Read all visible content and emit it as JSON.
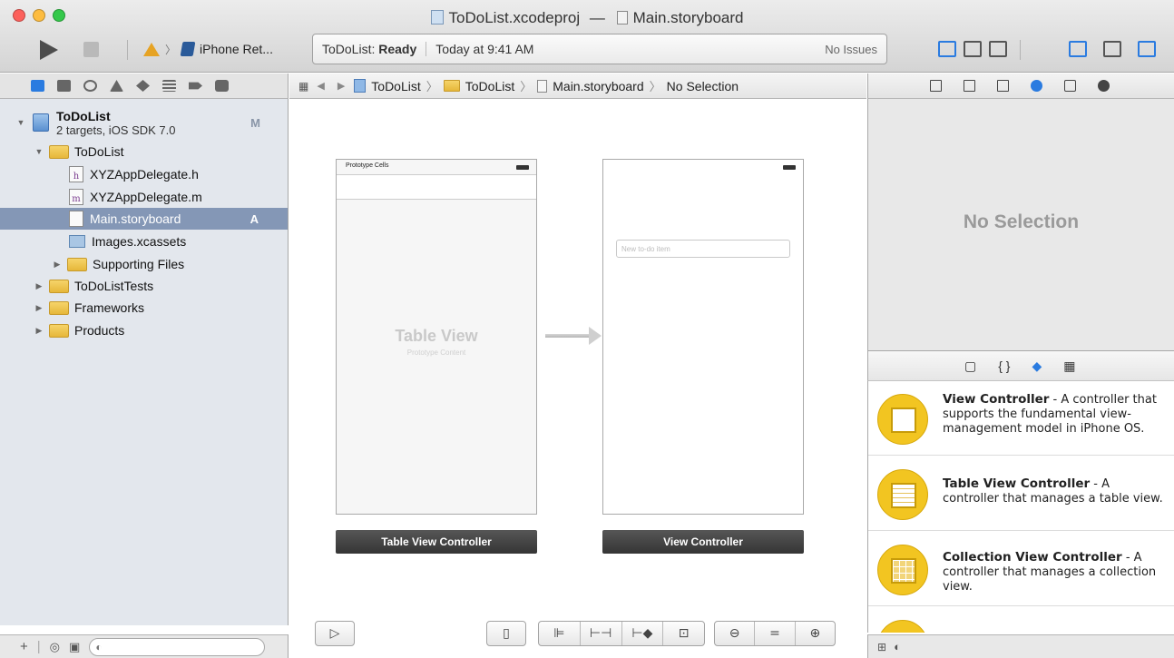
{
  "window": {
    "title_project": "ToDoList.xcodeproj",
    "title_sep": "—",
    "title_file": "Main.storyboard",
    "colors": {
      "close": "#fc605b",
      "minimize": "#fdbc40",
      "zoom": "#34c84a",
      "selection": "#8497b6",
      "accent_blue": "#2a7be0"
    }
  },
  "toolbar": {
    "scheme_device": "iPhone Ret...",
    "activity_project": "ToDoList:",
    "activity_status": "Ready",
    "activity_time": "Today at 9:41 AM",
    "activity_issues": "No Issues"
  },
  "navigator": {
    "project": {
      "name": "ToDoList",
      "subtitle": "2 targets, iOS SDK 7.0",
      "badge": "M"
    },
    "items": [
      {
        "label": "ToDoList"
      },
      {
        "label": "XYZAppDelegate.h"
      },
      {
        "label": "XYZAppDelegate.m"
      },
      {
        "label": "Main.storyboard",
        "badge": "A"
      },
      {
        "label": "Images.xcassets"
      },
      {
        "label": "Supporting Files"
      },
      {
        "label": "ToDoListTests"
      },
      {
        "label": "Frameworks"
      },
      {
        "label": "Products"
      }
    ]
  },
  "jumpbar": {
    "crumbs": [
      "ToDoList",
      "ToDoList",
      "Main.storyboard",
      "No Selection"
    ]
  },
  "canvas": {
    "table_scene": {
      "status_text": "Prototype Cells",
      "title": "Table View",
      "subtitle": "Prototype Content",
      "label": "Table View Controller"
    },
    "view_scene": {
      "placeholder": "New to-do item",
      "label": "View Controller"
    }
  },
  "inspector": {
    "empty_text": "No Selection"
  },
  "library": {
    "items": [
      {
        "title": "View Controller",
        "desc": " - A controller that supports the fundamental view-management model in iPhone OS."
      },
      {
        "title": "Table View Controller",
        "desc": " - A controller that manages a table view."
      },
      {
        "title": "Collection View Controller",
        "desc": " - A controller that manages a collection view."
      }
    ]
  }
}
